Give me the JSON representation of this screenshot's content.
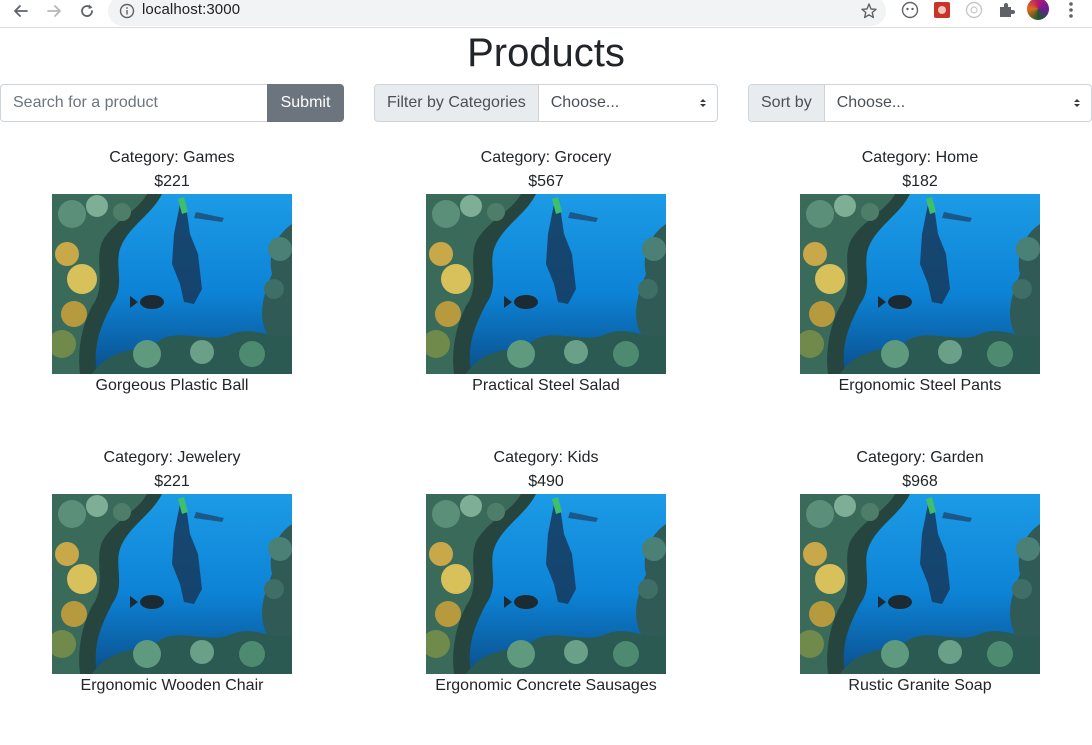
{
  "browser": {
    "url": "localhost:3000",
    "icons": [
      "back-arrow-icon",
      "forward-arrow-icon",
      "reload-icon",
      "info-icon",
      "star-icon",
      "extension-icon",
      "puzzle-icon",
      "profile-avatar",
      "more-menu-icon"
    ]
  },
  "page": {
    "title": "Products"
  },
  "search": {
    "placeholder": "Search for a product",
    "value": "",
    "submit_label": "Submit"
  },
  "filter": {
    "label": "Filter by Categories",
    "selected": "Choose..."
  },
  "sort": {
    "label": "Sort by",
    "selected": "Choose..."
  },
  "products": [
    {
      "category": "Category: Games",
      "price": "$221",
      "name": "Gorgeous Plastic Ball"
    },
    {
      "category": "Category: Grocery",
      "price": "$567",
      "name": "Practical Steel Salad"
    },
    {
      "category": "Category: Home",
      "price": "$182",
      "name": "Ergonomic Steel Pants"
    },
    {
      "category": "Category: Jewelery",
      "price": "$221",
      "name": "Ergonomic Wooden Chair"
    },
    {
      "category": "Category: Kids",
      "price": "$490",
      "name": "Ergonomic Concrete Sausages"
    },
    {
      "category": "Category: Garden",
      "price": "$968",
      "name": "Rustic Granite Soap"
    }
  ],
  "colors": {
    "submit_button": "#6c757d",
    "input_group_label": "#e9ecef",
    "border": "#ced4da",
    "text": "#212529"
  }
}
